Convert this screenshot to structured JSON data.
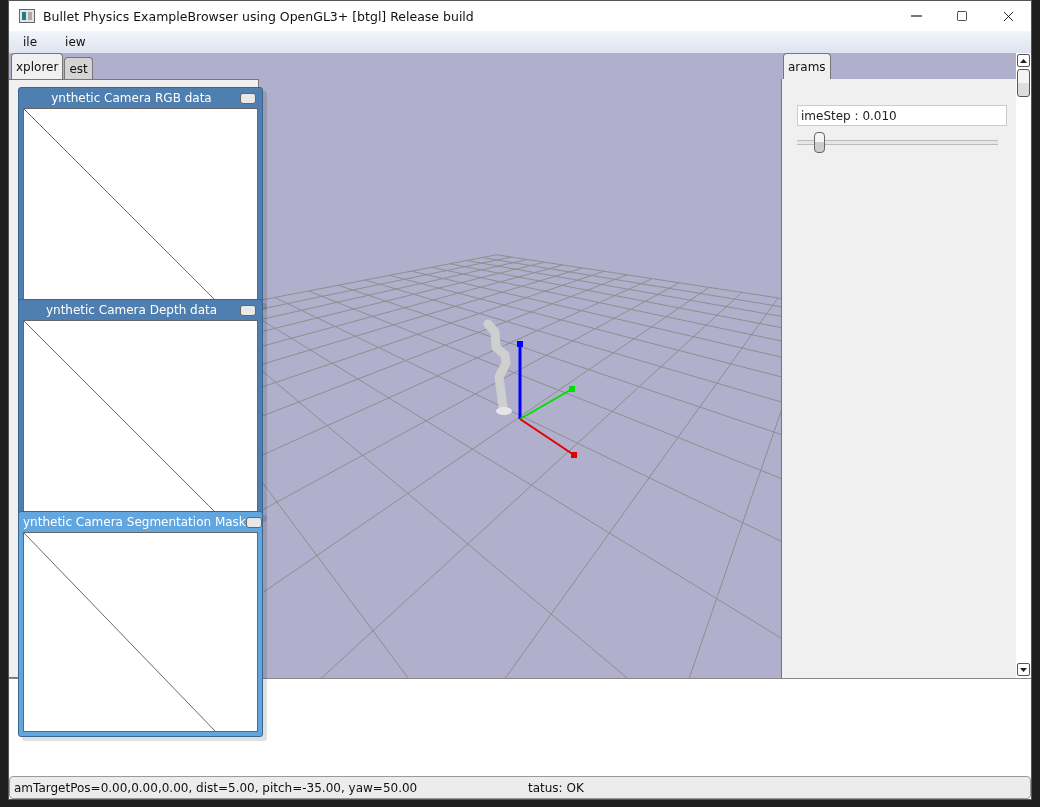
{
  "window": {
    "title": "Bullet Physics ExampleBrowser using OpenGL3+ [btgl] Release build"
  },
  "menu": [
    "ile",
    "iew"
  ],
  "left_tabs": [
    {
      "label": "xplorer",
      "selected": true
    },
    {
      "label": "est",
      "selected": false
    }
  ],
  "camera_windows": [
    {
      "title": "ynthetic Camera RGB data",
      "active": false
    },
    {
      "title": "ynthetic Camera Depth data",
      "active": false
    },
    {
      "title": "ynthetic Camera Segmentation Mask",
      "active": true
    }
  ],
  "params": {
    "tabs": [
      {
        "label": "arams",
        "selected": true
      }
    ],
    "slider": {
      "label": "imeStep : 0.010",
      "level": 0.11
    }
  },
  "status_bar": {
    "camera": "amTargetPos=0.00,0.00,0.00, dist=5.00, pitch=-35.00, yaw=50.00",
    "status": "tatus: OK"
  }
}
